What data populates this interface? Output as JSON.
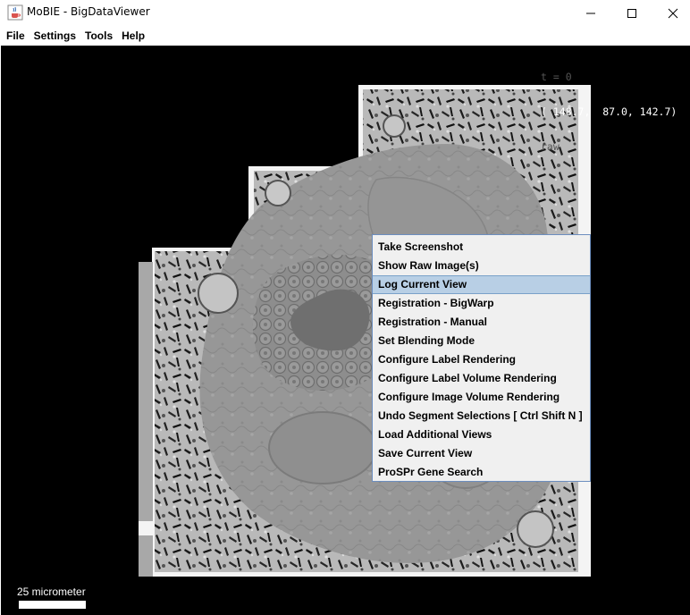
{
  "window": {
    "title": "MoBIE - BigDataViewer",
    "icons": {
      "app": "java-coffee-icon",
      "minimize": "minimize-icon",
      "maximize": "maximize-icon",
      "close": "close-icon"
    }
  },
  "menubar": {
    "items": [
      "File",
      "Settings",
      "Tools",
      "Help"
    ]
  },
  "viewer": {
    "timepoint": "t = 0",
    "coordinates": "( 148.7,  87.0, 142.7)",
    "source": "raw",
    "scale_bar_label": "25 micrometer"
  },
  "context_menu": {
    "items": [
      "Take Screenshot",
      "Show Raw Image(s)",
      "Log Current View",
      "Registration - BigWarp",
      "Registration - Manual",
      "Set Blending Mode",
      "Configure Label Rendering",
      "Configure Label Volume Rendering",
      "Configure Image Volume Rendering",
      "Undo Segment Selections [ Ctrl Shift N ]",
      "Load Additional Views",
      "Save Current View",
      "ProSPr Gene Search"
    ],
    "highlighted_index": 2
  },
  "colors": {
    "viewer_background": "#000000",
    "menu_highlight": "#b8cfe5",
    "menu_border": "#6c8ebf"
  }
}
